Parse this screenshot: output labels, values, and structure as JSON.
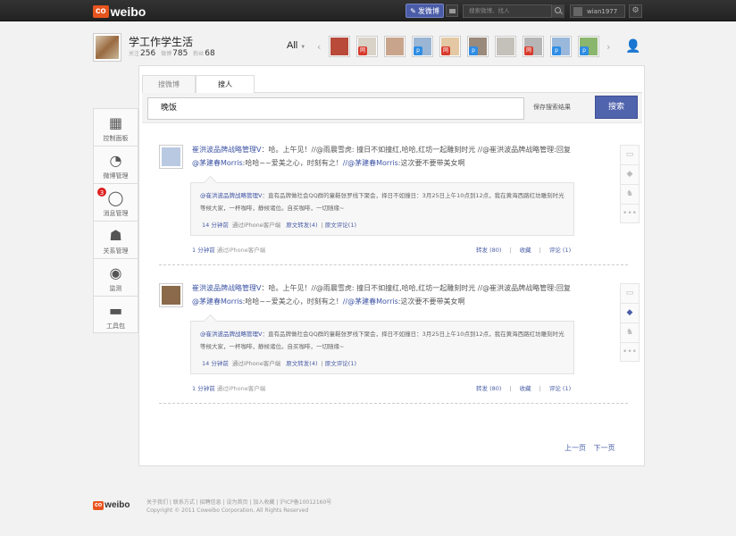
{
  "brand": {
    "logo_co": "co",
    "logo_weibo": "weibo"
  },
  "topbar": {
    "post_label": "发微博",
    "search_placeholder": "搜索微博、找人",
    "username": "wian1977"
  },
  "profile": {
    "name": "学工作学生活",
    "stats": [
      {
        "label": "关注",
        "value": "256"
      },
      {
        "label": "微博",
        "value": "785"
      },
      {
        "label": "粉丝",
        "value": "68"
      }
    ]
  },
  "filter": {
    "label": "All"
  },
  "friends": [
    {
      "color": "#b94a3a",
      "badge": "",
      "badge_color": ""
    },
    {
      "color": "#d9d2c7",
      "badge": "网",
      "badge_color": "#d83a2c"
    },
    {
      "color": "#c9a48c",
      "badge": "",
      "badge_color": ""
    },
    {
      "color": "#9ab6d4",
      "badge": "p",
      "badge_color": "#2f8de4"
    },
    {
      "color": "#e3c8a3",
      "badge": "网",
      "badge_color": "#d83a2c"
    },
    {
      "color": "#9a8a7c",
      "badge": "p",
      "badge_color": "#2f8de4"
    },
    {
      "color": "#c4c0ba",
      "badge": "",
      "badge_color": ""
    },
    {
      "color": "#b6b6b6",
      "badge": "网",
      "badge_color": "#d83a2c"
    },
    {
      "color": "#9ab8dc",
      "badge": "p",
      "badge_color": "#2f8de4"
    },
    {
      "color": "#8bb66d",
      "badge": "p",
      "badge_color": "#2f8de4"
    }
  ],
  "sidenav": [
    {
      "label": "控制面板",
      "icon": "clipboard-icon",
      "glyph": "▦",
      "note": ""
    },
    {
      "label": "微博管理",
      "icon": "broadcast-icon",
      "glyph": "◔",
      "note": ""
    },
    {
      "label": "消息管理",
      "icon": "chat-icon",
      "glyph": "◯",
      "note": "3"
    },
    {
      "label": "关系管理",
      "icon": "people-icon",
      "glyph": "☗",
      "note": ""
    },
    {
      "label": "监测",
      "icon": "eye-icon",
      "glyph": "◉",
      "note": ""
    },
    {
      "label": "工具包",
      "icon": "toolbox-icon",
      "glyph": "▬",
      "note": ""
    }
  ],
  "tabs": {
    "search_posts": "搜微博",
    "search_people": "搜人"
  },
  "search": {
    "query": "晚饭",
    "save_label": "保存搜索结果",
    "button_label": "搜索"
  },
  "posts": [
    {
      "author": "崔洪波品牌战略管理V",
      "text_a": "：哈。上午见！//@雨晨雪虎: 撞日不如撞红,哈哈,红坊一起雕刻时光 //@崔洪波品牌战略管理:回复",
      "mention": "@茅建春Morris",
      "text_b": ":哈哈~~爱美之心，时刻有之！",
      "mention2": "//@茅建春Morris",
      "text_c": ":这次要不要带美女啊",
      "quote_author": "@崔洪波品牌战略管理V",
      "quote_text": "：直有品牌做社会QQ群的童鞋张罗线下聚会，择日不如撞日：3月25日上午10点到12点，我在黄海西路红坊雕刻时光等候大家，一杯咖啡，静候诸位。自买咖啡，一切随缘~",
      "quote_time": "14 分钟前",
      "quote_via": "通过iPhone客户端",
      "quote_repost": "原文转发(4)",
      "quote_comment": "原文评论(1)",
      "time": "1 分钟前",
      "via": "通过iPhone客户端",
      "repost": "转发 (80)",
      "favorite": "收藏",
      "comment": "评论 (1)",
      "avatar_color": "#b9c9e2"
    },
    {
      "author": "崔洪波品牌战略管理V",
      "text_a": "：哈。上午见！//@雨晨雪虎: 撞日不如撞红,哈哈,红坊一起雕刻时光 //@崔洪波品牌战略管理:回复",
      "mention": "@茅建春Morris",
      "text_b": ":哈哈~~爱美之心，时刻有之！",
      "mention2": "//@茅建春Morris",
      "text_c": ":这次要不要带美女啊",
      "quote_author": "@崔洪波品牌战略管理V",
      "quote_text": "：直有品牌做社会QQ群的童鞋张罗线下聚会，择日不如撞日：3月25日上午10点到12点，我在黄海西路红坊雕刻时光等候大家，一杯咖啡，静候诸位。自买咖啡，一切随缘~",
      "quote_time": "14 分钟前",
      "quote_via": "通过iPhone客户端",
      "quote_repost": "原文转发(4)",
      "quote_comment": "原文评论(1)",
      "time": "1 分钟前",
      "via": "通过iPhone客户端",
      "repost": "转发 (80)",
      "favorite": "收藏",
      "comment": "评论 (1)",
      "avatar_color": "#8a6a4a"
    }
  ],
  "pager": {
    "prev": "上一页",
    "next": "下一页"
  },
  "footer": {
    "links": "关于我们 | 联系方式 | 招聘信息 | 设为首页 | 加入收藏 | 沪ICP备10012160号",
    "copyright": "Copyright © 2011 Coweibo Corporation, All Rights Reserved"
  }
}
